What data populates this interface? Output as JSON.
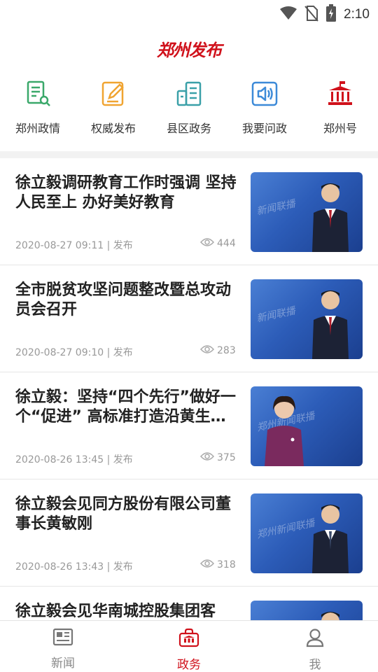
{
  "status_bar": {
    "time": "2:10",
    "icons": [
      "wifi-icon",
      "no-sim-icon",
      "battery-charging-icon"
    ]
  },
  "header": {
    "logo_text": "郑州发布"
  },
  "quick_nav": [
    {
      "label": "郑州政情",
      "icon": "document-pen-icon",
      "color": "#3aa86a"
    },
    {
      "label": "权威发布",
      "icon": "edit-note-icon",
      "color": "#f0a431"
    },
    {
      "label": "县区政务",
      "icon": "buildings-icon",
      "color": "#3aa0a8"
    },
    {
      "label": "我要问政",
      "icon": "speaker-icon",
      "color": "#3c8ad8"
    },
    {
      "label": "郑州号",
      "icon": "government-building-icon",
      "color": "#d0111b"
    }
  ],
  "news": [
    {
      "title": "徐立毅调研教育工作时强调 坚持人民至上 办好美好教育",
      "date": "2020-08-27 09:11",
      "source": "发布",
      "views": "444",
      "thumb_caption": "新闻联播"
    },
    {
      "title": "全市脱贫攻坚问题整改暨总攻动员会召开",
      "date": "2020-08-27 09:10",
      "source": "发布",
      "views": "283",
      "thumb_caption": "新闻联播"
    },
    {
      "title": "徐立毅：坚持“四个先行”做好一个“促进” 高标准打造沿黄生态保护示范区",
      "date": "2020-08-26 13:45",
      "source": "发布",
      "views": "375",
      "thumb_caption": "郑州新闻联播"
    },
    {
      "title": "徐立毅会见同方股份有限公司董事长黄敏刚",
      "date": "2020-08-26 13:43",
      "source": "发布",
      "views": "318",
      "thumb_caption": "郑州新闻联播"
    },
    {
      "title": "徐立毅会见华南城控股集团客",
      "date": "",
      "source": "",
      "views": "",
      "thumb_caption": ""
    }
  ],
  "tabs": [
    {
      "label": "新闻",
      "icon": "newspaper-icon",
      "active": false
    },
    {
      "label": "政务",
      "icon": "government-bag-icon",
      "active": true
    },
    {
      "label": "我",
      "icon": "user-icon",
      "active": false
    }
  ],
  "colors": {
    "brand": "#d0111b",
    "meta_text": "#999999",
    "divider": "#f2f2f2"
  }
}
